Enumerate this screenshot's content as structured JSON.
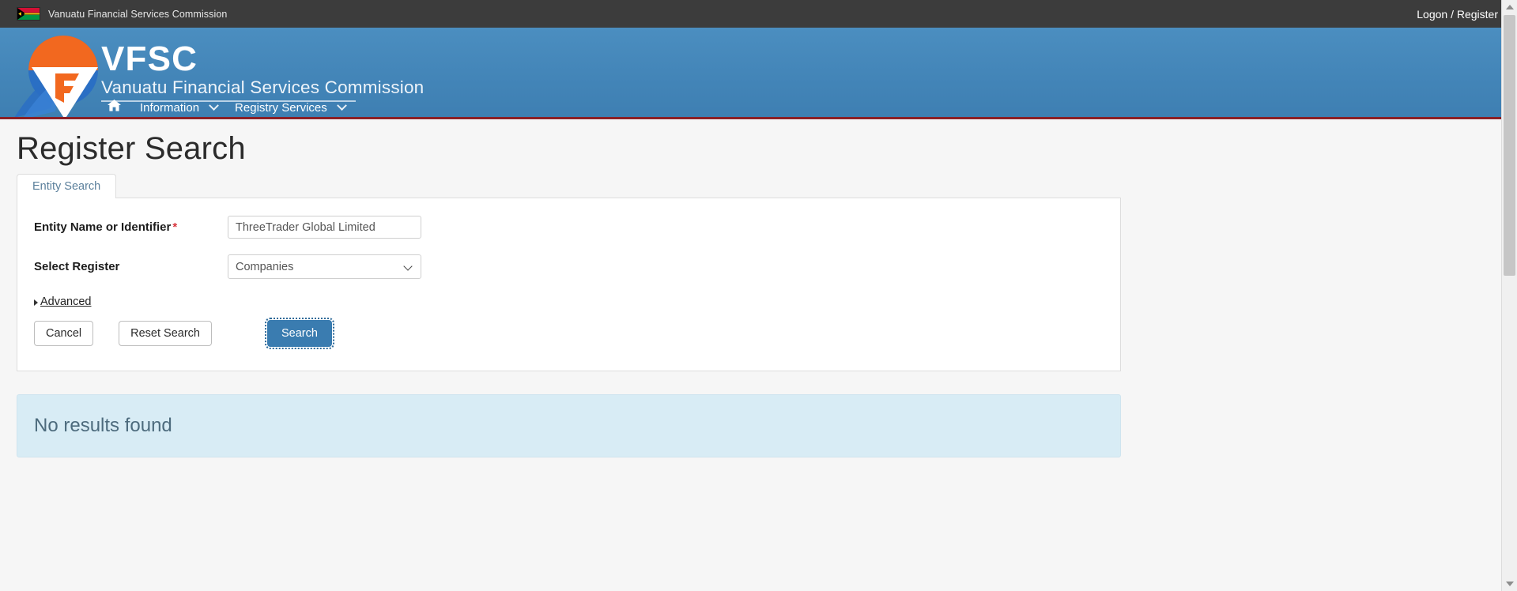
{
  "topbar": {
    "flag_icon": "vanuatu-flag-icon",
    "site_name": "Vanuatu Financial Services Commission",
    "logon_label": "Logon / Register"
  },
  "masthead": {
    "logo_icon": "vfsc-logo-icon",
    "acronym": "VFSC",
    "full_name": "Vanuatu Financial Services Commission"
  },
  "nav": {
    "home_icon": "home-icon",
    "items": [
      {
        "label": "Information",
        "icon": "chevron-down-icon"
      },
      {
        "label": "Registry Services",
        "icon": "chevron-down-icon"
      }
    ]
  },
  "main": {
    "page_title": "Register Search",
    "tabs": [
      {
        "label": "Entity Search"
      }
    ],
    "form": {
      "entity_label": "Entity Name or Identifier",
      "entity_required_marker": "*",
      "entity_value": "ThreeTrader Global Limited",
      "entity_placeholder": "",
      "register_label": "Select Register",
      "register_value": "Companies",
      "register_options": [
        "Companies"
      ],
      "register_chevron_icon": "chevron-down-icon",
      "advanced_label": "Advanced",
      "advanced_icon": "triangle-right-icon",
      "cancel_label": "Cancel",
      "reset_label": "Reset Search",
      "search_label": "Search"
    },
    "results": {
      "message": "No results found"
    }
  },
  "scrollbar": {
    "up_icon": "scroll-up-arrow-icon",
    "down_icon": "scroll-down-arrow-icon"
  },
  "colors": {
    "topbar_bg": "#3c3c3c",
    "masthead_blue": "#4385b8",
    "accent_red_rule": "#8a2026",
    "primary_button": "#3a7cb0",
    "results_panel": "#d8ecf5",
    "required_asterisk": "#d9363e",
    "logo_orange": "#f2681f"
  }
}
